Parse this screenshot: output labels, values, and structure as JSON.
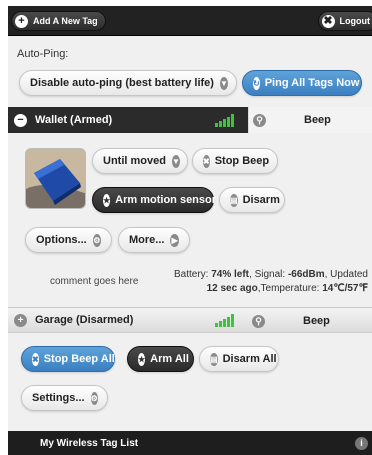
{
  "header": {
    "add_tag_label": "Add A New Tag",
    "logout_label": "Logout"
  },
  "autoping": {
    "label": "Auto-Ping:",
    "select_value": "Disable auto-ping (best battery life)",
    "ping_all_label": "Ping All Tags Now"
  },
  "tags": [
    {
      "name": "Wallet (Armed)",
      "state": "armed",
      "beep_label": "Beep",
      "until_label": "Until moved",
      "stop_beep_label": "Stop Beep",
      "arm_motion_label": "Arm motion sensor",
      "disarm_label": "Disarm",
      "options_label": "Options...",
      "more_label": "More...",
      "comment": "comment goes here",
      "battery_prefix": "Battery: ",
      "battery_value": "74% left",
      "signal_prefix": ", Signal: ",
      "signal_value": "-66dBm",
      "updated_prefix": ", Updated",
      "updated_value": "12 sec ago",
      "temp_prefix": ",Temperature: ",
      "temp_value": "14℃/57℉"
    },
    {
      "name": "Garage (Disarmed)",
      "state": "disarmed",
      "beep_label": "Beep"
    }
  ],
  "actions": {
    "stop_beep_all_label": "Stop Beep All",
    "arm_all_label": "Arm All",
    "disarm_all_label": "Disarm All",
    "settings_label": "Settings..."
  },
  "footer": {
    "title": "My Wireless Tag List"
  },
  "colors": {
    "accent_blue": "#3b7fc1",
    "signal_green": "#3ec33e",
    "dark_bar": "#2b2b2b"
  }
}
